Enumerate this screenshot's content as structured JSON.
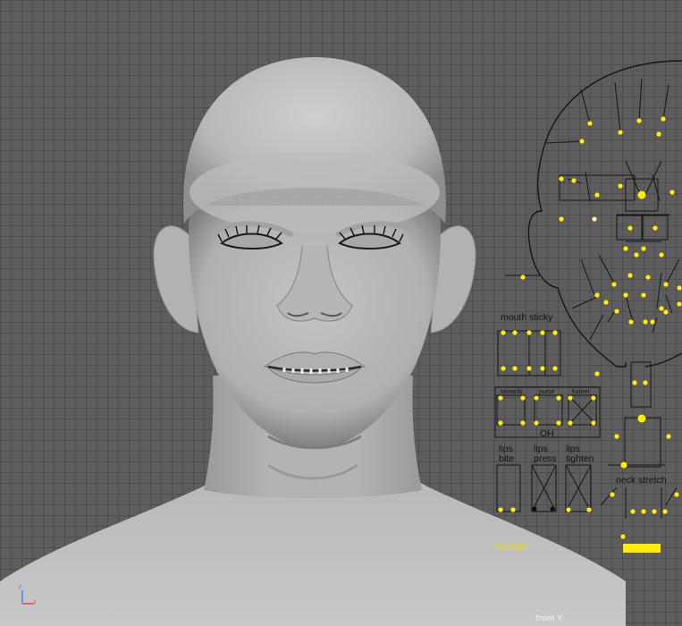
{
  "viewport": {
    "camera_label": "front Y",
    "background_color": "#5d5d5d",
    "grid_color": "#3c3c3c"
  },
  "rig_panel": {
    "accent_color": "#ffee00",
    "line_color": "#151515",
    "labels": {
      "mouth_sticky": "mouth sticky",
      "towards": "towards",
      "purse": "purse",
      "funnel": "funnel",
      "oh": "OH",
      "lips_bite_1": "lips",
      "lips_bite_2": "bite",
      "lips_press_1": "lips",
      "lips_press_2": "press",
      "lips_tighten_1": "lips",
      "lips_tighten_2": "tighten",
      "neck_stretch": "neck stretch",
      "rig_logic": "rig logic"
    }
  },
  "axis_gizmo": {
    "up_axis": "z",
    "side_axis": "x"
  },
  "model": {
    "name": "head mesh",
    "skin_color": "#bdbdbd"
  }
}
